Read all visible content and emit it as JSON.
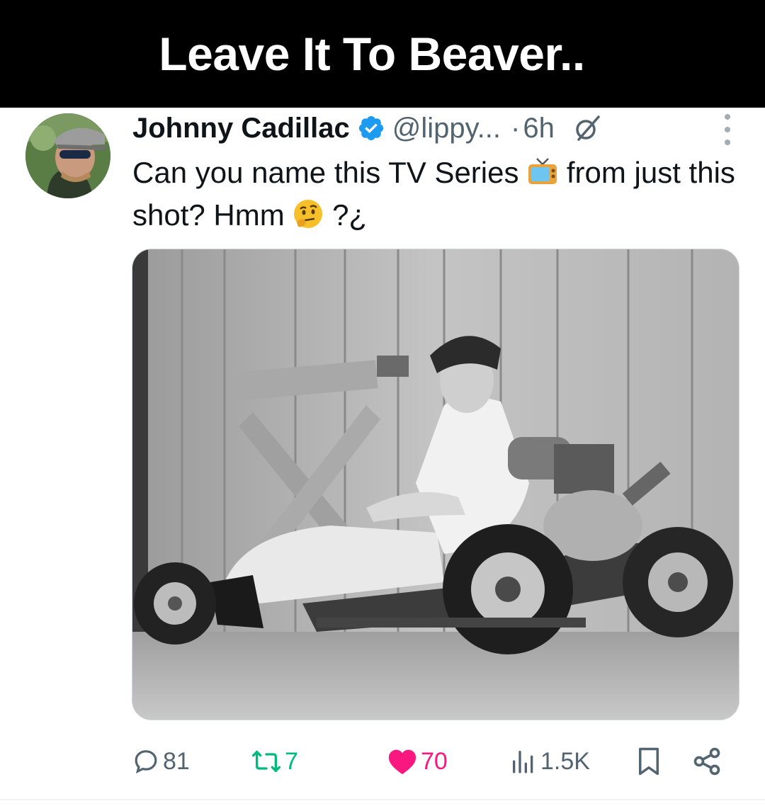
{
  "banner": {
    "title": "Leave It To Beaver.."
  },
  "post": {
    "author_name": "Johnny Cadillac",
    "handle": "@lippy...",
    "separator": "·",
    "time": "6h",
    "text_part1": "Can you name this TV Series",
    "text_part2": "from just this shot? Hmm",
    "text_part3": "?¿",
    "emoji_tv": "tv-emoji",
    "emoji_thinking": "thinking-face-emoji"
  },
  "actions": {
    "replies": "81",
    "reposts": "7",
    "likes": "70",
    "views": "1.5K"
  },
  "colors": {
    "banner_bg": "#000000",
    "verified": "#1d9bf0",
    "like": "#f91880",
    "muted": "#536471"
  },
  "icons": [
    "verified-badge-icon",
    "grok-icon",
    "more-icon",
    "reply-icon",
    "repost-icon",
    "like-icon",
    "views-icon",
    "bookmark-icon",
    "share-icon"
  ]
}
